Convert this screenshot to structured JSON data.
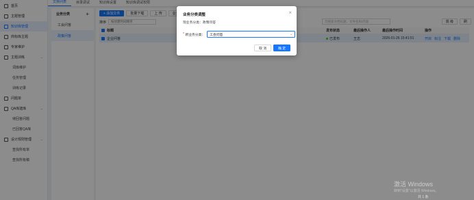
{
  "sidebar": {
    "items": [
      {
        "label": "首页",
        "icon": "home-icon"
      },
      {
        "label": "主题管理",
        "icon": "grid-icon"
      },
      {
        "label": "知识库管理",
        "icon": "book-icon",
        "active": true
      },
      {
        "label": "商标库主题",
        "icon": "tag-icon"
      },
      {
        "label": "专家维护",
        "icon": "user-icon"
      },
      {
        "label": "主题训练",
        "icon": "train-icon",
        "expand": true
      },
      {
        "label": "词库维护",
        "sub": true
      },
      {
        "label": "任务管理",
        "sub": true
      },
      {
        "label": "训练记录",
        "sub": true
      },
      {
        "label": "问题单",
        "icon": "ticket-icon"
      },
      {
        "label": "QA库建库",
        "icon": "qa-icon",
        "expand": true
      },
      {
        "label": "待回答问题",
        "sub": true
      },
      {
        "label": "已回答QA库",
        "sub": true
      },
      {
        "label": "设计规则管理",
        "icon": "rule-icon",
        "expand": true
      },
      {
        "label": "查找所有单",
        "sub": true
      },
      {
        "label": "查找所有稿",
        "sub": true
      }
    ]
  },
  "topbar": {
    "tabs": [
      "文档列表",
      "目录调试",
      "知识库设置",
      "知识库调试权限"
    ]
  },
  "category": {
    "title": "业务分类",
    "items": [
      "工会问答",
      "政策问答"
    ],
    "active_index": 1
  },
  "toolbar": {
    "buttons": [
      "+ 添加文件",
      "批量下载",
      "上 传",
      "业务分"
    ]
  },
  "filter": {
    "label": "排序",
    "value": "按创建时间降序",
    "search_placeholder": "可搜索文档标题、文件名称/内容",
    "right_buttons": [
      "高 级",
      "刷"
    ]
  },
  "table": {
    "headers": [
      "标题",
      "发布状态",
      "最后操作人",
      "最后操作时间",
      "操作"
    ],
    "rows": [
      {
        "title": "企业问答",
        "status": "已发布",
        "operator": "王志",
        "time": "2026-01-26 15:41:51",
        "actions": [
          "开启",
          "标注",
          "下载",
          "删除"
        ]
      }
    ]
  },
  "modal": {
    "title": "业务分类调整",
    "current_label": "现业务分类：",
    "current_value": "政策问答",
    "field_label": "新业务分类：",
    "field_value": "工会问答",
    "cancel_label": "取 消",
    "ok_label": "确 定"
  },
  "watermark": {
    "line1": "激活 Windows",
    "line2": "转到\"设置\"以激活 Windows。"
  },
  "pager": {
    "text": "共 1 条"
  }
}
